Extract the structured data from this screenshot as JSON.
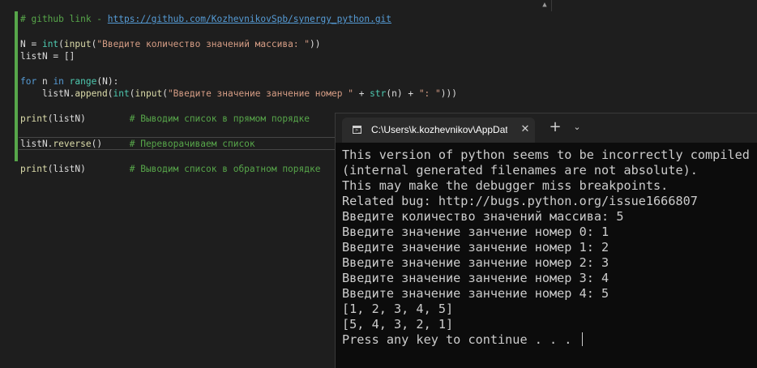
{
  "editor": {
    "scroll_arrow": "▲",
    "lines": [
      {
        "segments": [
          {
            "cls": "cmt",
            "text": "# github link - "
          },
          {
            "cls": "url",
            "text": "https://github.com/KozhevnikovSpb/synergy_python.git"
          }
        ]
      },
      {
        "segments": []
      },
      {
        "segments": [
          {
            "cls": "var",
            "text": "N = "
          },
          {
            "cls": "fn",
            "text": "int"
          },
          {
            "cls": "var",
            "text": "("
          },
          {
            "cls": "call",
            "text": "input"
          },
          {
            "cls": "var",
            "text": "("
          },
          {
            "cls": "str",
            "text": "\"Введите количество значений массива: \""
          },
          {
            "cls": "var",
            "text": "))"
          }
        ]
      },
      {
        "segments": [
          {
            "cls": "var",
            "text": "listN = []"
          }
        ]
      },
      {
        "segments": []
      },
      {
        "segments": [
          {
            "cls": "kw",
            "text": "for"
          },
          {
            "cls": "var",
            "text": " n "
          },
          {
            "cls": "kw",
            "text": "in"
          },
          {
            "cls": "var",
            "text": " "
          },
          {
            "cls": "fn",
            "text": "range"
          },
          {
            "cls": "var",
            "text": "(N):"
          }
        ]
      },
      {
        "segments": [
          {
            "cls": "var",
            "text": "    listN."
          },
          {
            "cls": "call",
            "text": "append"
          },
          {
            "cls": "var",
            "text": "("
          },
          {
            "cls": "fn",
            "text": "int"
          },
          {
            "cls": "var",
            "text": "("
          },
          {
            "cls": "call",
            "text": "input"
          },
          {
            "cls": "var",
            "text": "("
          },
          {
            "cls": "str",
            "text": "\"Введите значение занчение номер \""
          },
          {
            "cls": "var",
            "text": " + "
          },
          {
            "cls": "fn",
            "text": "str"
          },
          {
            "cls": "var",
            "text": "(n) + "
          },
          {
            "cls": "str",
            "text": "\": \""
          },
          {
            "cls": "var",
            "text": ")))"
          }
        ]
      },
      {
        "segments": []
      },
      {
        "segments": [
          {
            "cls": "call",
            "text": "print"
          },
          {
            "cls": "var",
            "text": "(listN)        "
          },
          {
            "cls": "cmt",
            "text": "# Выводим список в прямом порядке"
          }
        ]
      },
      {
        "segments": []
      },
      {
        "segments": [
          {
            "cls": "var",
            "text": "listN."
          },
          {
            "cls": "call",
            "text": "reverse"
          },
          {
            "cls": "var",
            "text": "()     "
          },
          {
            "cls": "cmt",
            "text": "# Переворачиваем список"
          }
        ]
      },
      {
        "segments": []
      },
      {
        "segments": [
          {
            "cls": "call",
            "text": "print"
          },
          {
            "cls": "var",
            "text": "(listN)        "
          },
          {
            "cls": "cmt",
            "text": "# Выводим список в обратном порядке"
          }
        ]
      }
    ]
  },
  "terminal": {
    "tab_title": "C:\\Users\\k.kozhevnikov\\AppData\\Local\\Programs\\Python\\python.exe",
    "close_glyph": "✕",
    "new_tab_glyph": "+",
    "dropdown_glyph": "⌄",
    "output": [
      "This version of python seems to be incorrectly compiled",
      "(internal generated filenames are not absolute).",
      "This may make the debugger miss breakpoints.",
      "Related bug: http://bugs.python.org/issue1666807",
      "Введите количество значений массива: 5",
      "Введите значение занчение номер 0: 1",
      "Введите значение занчение номер 1: 2",
      "Введите значение занчение номер 2: 3",
      "Введите значение занчение номер 3: 4",
      "Введите значение занчение номер 4: 5",
      "[1, 2, 3, 4, 5]",
      "[5, 4, 3, 2, 1]",
      "Press any key to continue . . . "
    ]
  }
}
